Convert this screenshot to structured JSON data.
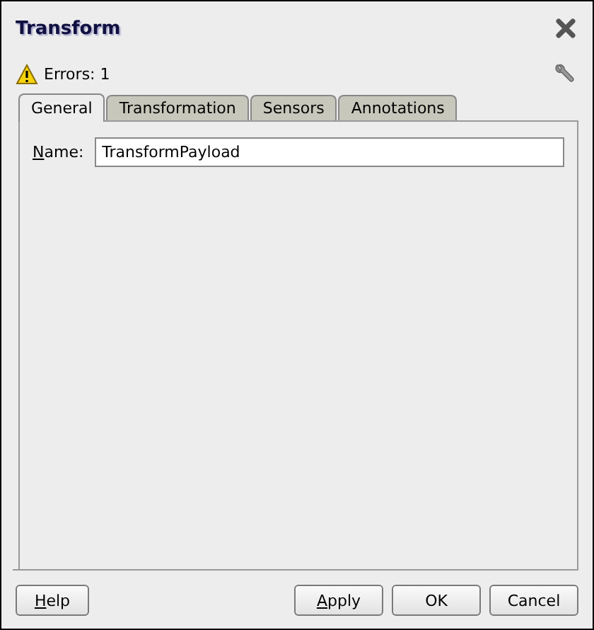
{
  "window": {
    "title": "Transform"
  },
  "errors": {
    "label": "Errors: 1"
  },
  "tabs": [
    {
      "label": "General",
      "selected": true
    },
    {
      "label": "Transformation",
      "selected": false
    },
    {
      "label": "Sensors",
      "selected": false
    },
    {
      "label": "Annotations",
      "selected": false
    }
  ],
  "name_field": {
    "label": "Name:",
    "mnemonic_underlined": true,
    "value": "TransformPayload"
  },
  "buttons": [
    {
      "label": "Help",
      "mnemonic_underlined": true,
      "kind": "left"
    },
    {
      "label": "Apply",
      "mnemonic_underlined": true,
      "kind": "right"
    },
    {
      "label": "OK",
      "mnemonic_underlined": false,
      "kind": "right"
    },
    {
      "label": "Cancel",
      "mnemonic_underlined": false,
      "kind": "right"
    }
  ]
}
